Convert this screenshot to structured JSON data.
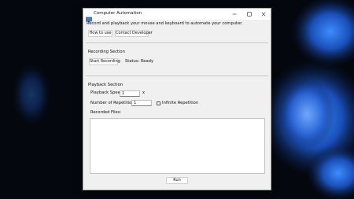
{
  "window": {
    "title": "Computer Automation"
  },
  "header": {
    "description": "Record and playback your mouse and keyboard to automate your computer.",
    "how_to_label": "How to use",
    "contact_label": "Contact Developer"
  },
  "recording": {
    "section_title": "Recording Section",
    "start_label": "Start Recording",
    "status_text": "Status: Ready"
  },
  "playback": {
    "section_title": "Playback Section",
    "speed_label": "Playback Speed:",
    "speed_value": "1",
    "speed_unit": "x",
    "repetitions_label": "Number of Repetitions:",
    "repetitions_value": "1",
    "infinite_label": "Infinite Repetition",
    "infinite_checked": false,
    "files_label": "Recorded Files:",
    "files": []
  },
  "footer": {
    "run_label": "Run"
  },
  "icons": {
    "app": "window-app-icon",
    "minimize": "minimize-icon",
    "maximize": "maximize-icon",
    "close": "close-icon"
  },
  "colors": {
    "window_bg": "#f0f0f0",
    "titlebar_bg": "#ffffff",
    "desktop_bg": "#04070d",
    "wallpaper_accent": "#1f5ed0"
  }
}
